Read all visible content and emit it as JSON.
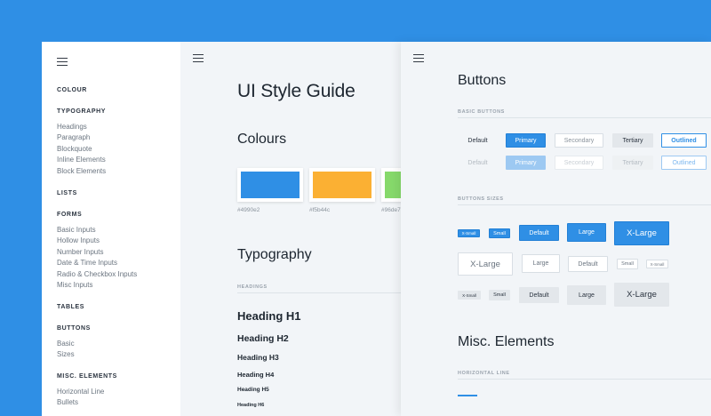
{
  "sidebar": {
    "sections": [
      {
        "title": "COLOUR",
        "items": []
      },
      {
        "title": "TYPOGRAPHY",
        "items": [
          "Headings",
          "Paragraph",
          "Blockquote",
          "Inline Elements",
          "Block Elements"
        ]
      },
      {
        "title": "LISTS",
        "items": []
      },
      {
        "title": "FORMS",
        "items": [
          "Basic Inputs",
          "Hollow Inputs",
          "Number Inputs",
          "Date & Time Inputs",
          "Radio & Checkbox Inputs",
          "Misc Inputs"
        ]
      },
      {
        "title": "TABLES",
        "items": []
      },
      {
        "title": "BUTTONS",
        "items": [
          "Basic",
          "Sizes"
        ]
      },
      {
        "title": "MISC. ELEMENTS",
        "items": [
          "Horizontal Line",
          "Bullets"
        ]
      }
    ]
  },
  "page1": {
    "title": "UI Style Guide",
    "colours_heading": "Colours",
    "swatches": [
      {
        "hex": "#4990e2",
        "label": "#4990e2"
      },
      {
        "hex": "#f5b041",
        "label": "#f5b44c"
      },
      {
        "hex": "#8edc6a",
        "label": "#96de7"
      }
    ],
    "typography_heading": "Typography",
    "headings_label": "HEADINGS",
    "headings": [
      "Heading H1",
      "Heading H2",
      "Heading H3",
      "Heading H4",
      "Heading H5",
      "Heading H6"
    ]
  },
  "page2": {
    "buttons_heading": "Buttons",
    "basic_label": "BASIC BUTTONS",
    "basic_buttons": [
      "Default",
      "Primary",
      "Secondary",
      "Tertiary",
      "Outlined"
    ],
    "sizes_label": "BUTTONS SIZES",
    "size_labels": [
      "X-Small",
      "Small",
      "Default",
      "Large",
      "X-Large"
    ],
    "misc_heading": "Misc. Elements",
    "hline_label": "HORIZONTAL LINE"
  },
  "colors": {
    "background": "#2f8fe5",
    "primary": "#2f8fe5",
    "page": "#f2f5f8"
  }
}
